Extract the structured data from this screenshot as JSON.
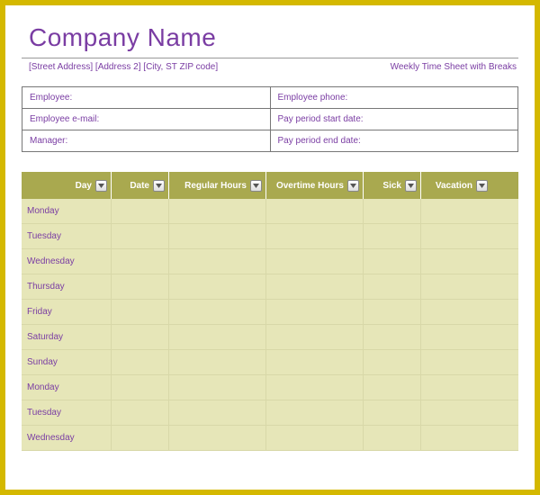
{
  "title": "Company Name",
  "address": "[Street Address] [Address 2] [City, ST ZIP code]",
  "doc_label": "Weekly Time Sheet with Breaks",
  "info": {
    "employee": "Employee:",
    "employee_phone": "Employee phone:",
    "employee_email": "Employee e-mail:",
    "pay_start": "Pay period start date:",
    "manager": "Manager:",
    "pay_end": "Pay period end date:"
  },
  "columns": {
    "day": "Day",
    "date": "Date",
    "regular": "Regular Hours",
    "overtime": "Overtime Hours",
    "sick": "Sick",
    "vacation": "Vacation"
  },
  "rows": [
    {
      "day": "Monday"
    },
    {
      "day": "Tuesday"
    },
    {
      "day": "Wednesday"
    },
    {
      "day": "Thursday"
    },
    {
      "day": "Friday"
    },
    {
      "day": "Saturday"
    },
    {
      "day": "Sunday"
    },
    {
      "day": "Monday"
    },
    {
      "day": "Tuesday"
    },
    {
      "day": "Wednesday"
    }
  ]
}
